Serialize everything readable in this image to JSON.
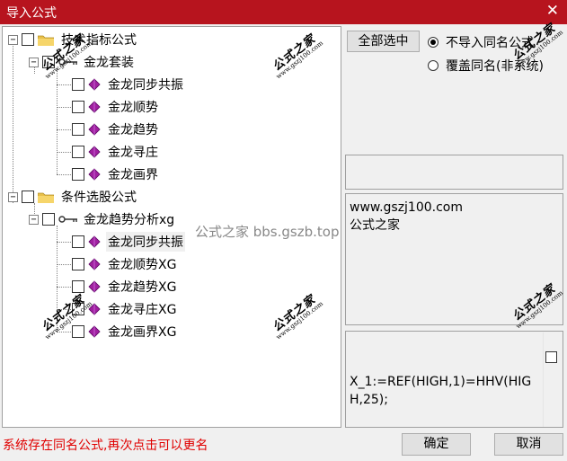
{
  "window": {
    "title": "导入公式",
    "close_glyph": "✕"
  },
  "tree": {
    "group1": {
      "label": "技术指标公式",
      "sub": {
        "label": "金龙套装",
        "items": [
          "金龙同步共振",
          "金龙顺势",
          "金龙趋势",
          "金龙寻庄",
          "金龙画界"
        ]
      }
    },
    "group2": {
      "label": "条件选股公式",
      "sub": {
        "label": "金龙趋势分析xg",
        "items": [
          "金龙同步共振",
          "金龙顺势XG",
          "金龙趋势XG",
          "金龙寻庄XG",
          "金龙画界XG"
        ]
      }
    },
    "selected_item": "金龙同步共振"
  },
  "watermark": {
    "big": "公式之家",
    "small": "www.gszj100.com",
    "overlay": "公式之家 bbs.gszb.top"
  },
  "options": {
    "select_all_label": "全部选中",
    "radio1_label": "不导入同名公式",
    "radio2_label": "覆盖同名(非系统)",
    "selected_radio": 1
  },
  "description": {
    "line1": "www.gszj100.com",
    "line2": "公式之家"
  },
  "code": "X_1:=REF(HIGH,1)=HHV(HIGH,25);",
  "status_message": "系统存在同名公式,再次点击可以更名",
  "buttons": {
    "ok": "确定",
    "cancel": "取消"
  },
  "colors": {
    "titlebar": "#b7141e",
    "status": "#e00000",
    "gem": "#8b008b"
  }
}
